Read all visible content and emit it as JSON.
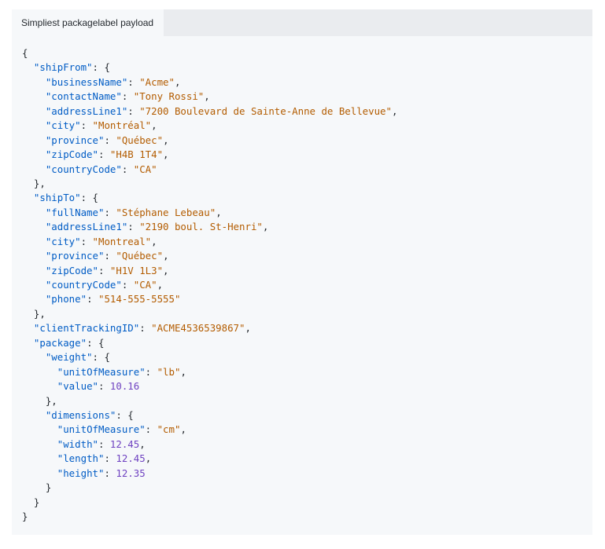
{
  "tab": {
    "label": "Simpliest packagelabel payload"
  },
  "code_lines": [
    {
      "indent": 0,
      "tokens": [
        [
          "p",
          "{"
        ]
      ]
    },
    {
      "indent": 2,
      "tokens": [
        [
          "k",
          "\"shipFrom\""
        ],
        [
          "p",
          ": {"
        ]
      ]
    },
    {
      "indent": 4,
      "tokens": [
        [
          "k",
          "\"businessName\""
        ],
        [
          "p",
          ": "
        ],
        [
          "s",
          "\"Acme\""
        ],
        [
          "p",
          ","
        ]
      ]
    },
    {
      "indent": 4,
      "tokens": [
        [
          "k",
          "\"contactName\""
        ],
        [
          "p",
          ": "
        ],
        [
          "s",
          "\"Tony Rossi\""
        ],
        [
          "p",
          ","
        ]
      ]
    },
    {
      "indent": 4,
      "tokens": [
        [
          "k",
          "\"addressLine1\""
        ],
        [
          "p",
          ": "
        ],
        [
          "s",
          "\"7200 Boulevard de Sainte-Anne de Bellevue\""
        ],
        [
          "p",
          ","
        ]
      ]
    },
    {
      "indent": 4,
      "tokens": [
        [
          "k",
          "\"city\""
        ],
        [
          "p",
          ": "
        ],
        [
          "s",
          "\"Montréal\""
        ],
        [
          "p",
          ","
        ]
      ]
    },
    {
      "indent": 4,
      "tokens": [
        [
          "k",
          "\"province\""
        ],
        [
          "p",
          ": "
        ],
        [
          "s",
          "\"Québec\""
        ],
        [
          "p",
          ","
        ]
      ]
    },
    {
      "indent": 4,
      "tokens": [
        [
          "k",
          "\"zipCode\""
        ],
        [
          "p",
          ": "
        ],
        [
          "s",
          "\"H4B 1T4\""
        ],
        [
          "p",
          ","
        ]
      ]
    },
    {
      "indent": 4,
      "tokens": [
        [
          "k",
          "\"countryCode\""
        ],
        [
          "p",
          ": "
        ],
        [
          "s",
          "\"CA\""
        ]
      ]
    },
    {
      "indent": 2,
      "tokens": [
        [
          "p",
          "},"
        ]
      ]
    },
    {
      "indent": 2,
      "tokens": [
        [
          "k",
          "\"shipTo\""
        ],
        [
          "p",
          ": {"
        ]
      ]
    },
    {
      "indent": 4,
      "tokens": [
        [
          "k",
          "\"fullName\""
        ],
        [
          "p",
          ": "
        ],
        [
          "s",
          "\"Stéphane Lebeau\""
        ],
        [
          "p",
          ","
        ]
      ]
    },
    {
      "indent": 4,
      "tokens": [
        [
          "k",
          "\"addressLine1\""
        ],
        [
          "p",
          ": "
        ],
        [
          "s",
          "\"2190 boul. St-Henri\""
        ],
        [
          "p",
          ","
        ]
      ]
    },
    {
      "indent": 4,
      "tokens": [
        [
          "k",
          "\"city\""
        ],
        [
          "p",
          ": "
        ],
        [
          "s",
          "\"Montreal\""
        ],
        [
          "p",
          ","
        ]
      ]
    },
    {
      "indent": 4,
      "tokens": [
        [
          "k",
          "\"province\""
        ],
        [
          "p",
          ": "
        ],
        [
          "s",
          "\"Québec\""
        ],
        [
          "p",
          ","
        ]
      ]
    },
    {
      "indent": 4,
      "tokens": [
        [
          "k",
          "\"zipCode\""
        ],
        [
          "p",
          ": "
        ],
        [
          "s",
          "\"H1V 1L3\""
        ],
        [
          "p",
          ","
        ]
      ]
    },
    {
      "indent": 4,
      "tokens": [
        [
          "k",
          "\"countryCode\""
        ],
        [
          "p",
          ": "
        ],
        [
          "s",
          "\"CA\""
        ],
        [
          "p",
          ","
        ]
      ]
    },
    {
      "indent": 4,
      "tokens": [
        [
          "k",
          "\"phone\""
        ],
        [
          "p",
          ": "
        ],
        [
          "s",
          "\"514-555-5555\""
        ]
      ]
    },
    {
      "indent": 2,
      "tokens": [
        [
          "p",
          "},"
        ]
      ]
    },
    {
      "indent": 2,
      "tokens": [
        [
          "k",
          "\"clientTrackingID\""
        ],
        [
          "p",
          ": "
        ],
        [
          "s",
          "\"ACME4536539867\""
        ],
        [
          "p",
          ","
        ]
      ]
    },
    {
      "indent": 2,
      "tokens": [
        [
          "k",
          "\"package\""
        ],
        [
          "p",
          ": {"
        ]
      ]
    },
    {
      "indent": 4,
      "tokens": [
        [
          "k",
          "\"weight\""
        ],
        [
          "p",
          ": {"
        ]
      ]
    },
    {
      "indent": 6,
      "tokens": [
        [
          "k",
          "\"unitOfMeasure\""
        ],
        [
          "p",
          ": "
        ],
        [
          "s",
          "\"lb\""
        ],
        [
          "p",
          ","
        ]
      ]
    },
    {
      "indent": 6,
      "tokens": [
        [
          "k",
          "\"value\""
        ],
        [
          "p",
          ": "
        ],
        [
          "n",
          "10.16"
        ]
      ]
    },
    {
      "indent": 4,
      "tokens": [
        [
          "p",
          "},"
        ]
      ]
    },
    {
      "indent": 4,
      "tokens": [
        [
          "k",
          "\"dimensions\""
        ],
        [
          "p",
          ": {"
        ]
      ]
    },
    {
      "indent": 6,
      "tokens": [
        [
          "k",
          "\"unitOfMeasure\""
        ],
        [
          "p",
          ": "
        ],
        [
          "s",
          "\"cm\""
        ],
        [
          "p",
          ","
        ]
      ]
    },
    {
      "indent": 6,
      "tokens": [
        [
          "k",
          "\"width\""
        ],
        [
          "p",
          ": "
        ],
        [
          "n",
          "12.45"
        ],
        [
          "p",
          ","
        ]
      ]
    },
    {
      "indent": 6,
      "tokens": [
        [
          "k",
          "\"length\""
        ],
        [
          "p",
          ": "
        ],
        [
          "n",
          "12.45"
        ],
        [
          "p",
          ","
        ]
      ]
    },
    {
      "indent": 6,
      "tokens": [
        [
          "k",
          "\"height\""
        ],
        [
          "p",
          ": "
        ],
        [
          "n",
          "12.35"
        ]
      ]
    },
    {
      "indent": 4,
      "tokens": [
        [
          "p",
          "}"
        ]
      ]
    },
    {
      "indent": 2,
      "tokens": [
        [
          "p",
          "}"
        ]
      ]
    },
    {
      "indent": 0,
      "tokens": [
        [
          "p",
          "}"
        ]
      ]
    }
  ]
}
